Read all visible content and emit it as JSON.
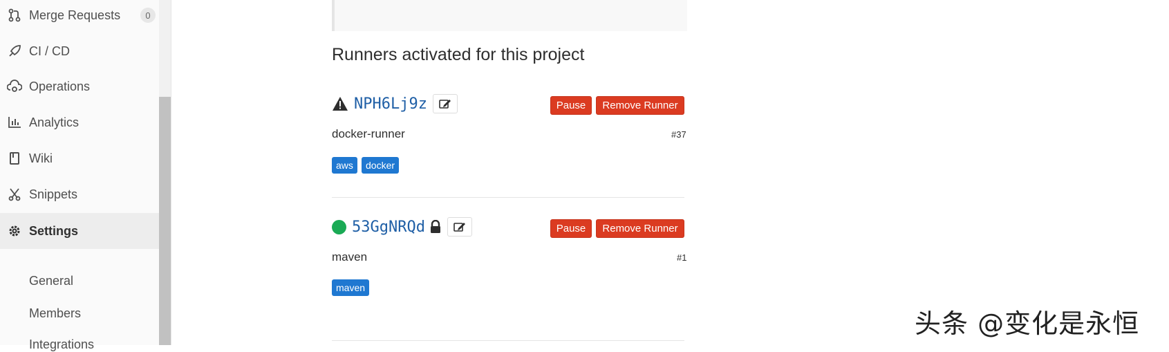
{
  "sidebar": {
    "items": [
      {
        "label": "Merge Requests",
        "icon": "merge-request-icon",
        "badge": "0"
      },
      {
        "label": "CI / CD",
        "icon": "rocket-icon"
      },
      {
        "label": "Operations",
        "icon": "cloud-gear-icon"
      },
      {
        "label": "Analytics",
        "icon": "chart-icon"
      },
      {
        "label": "Wiki",
        "icon": "book-icon"
      },
      {
        "label": "Snippets",
        "icon": "scissors-icon"
      },
      {
        "label": "Settings",
        "icon": "gear-icon"
      }
    ],
    "sub_items": [
      "General",
      "Members",
      "Integrations"
    ]
  },
  "main": {
    "heading": "Runners activated for this project",
    "runners": [
      {
        "id": "NPH6Lj9z",
        "status_icon": "warning-icon",
        "description": "docker-runner",
        "number": "#37",
        "tags": [
          "aws",
          "docker"
        ],
        "locked": false
      },
      {
        "id": "53GgNRQd",
        "status_icon": "online-dot-icon",
        "description": "maven",
        "number": "#1",
        "tags": [
          "maven"
        ],
        "locked": true
      }
    ],
    "buttons": {
      "pause": "Pause",
      "remove": "Remove Runner"
    }
  },
  "watermark": "头条 @变化是永恒",
  "colors": {
    "danger": "#db3b21",
    "tag": "#1f78d1",
    "link": "#1f5fa6",
    "online": "#1aaa55"
  }
}
